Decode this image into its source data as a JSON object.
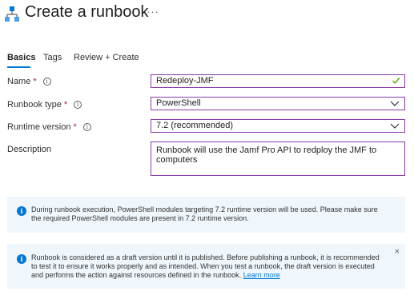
{
  "header": {
    "title": "Create a runbook",
    "more_label": "···"
  },
  "tabs": [
    {
      "label": "Basics",
      "active": true
    },
    {
      "label": "Tags",
      "active": false
    },
    {
      "label": "Review + Create",
      "active": false
    }
  ],
  "form": {
    "name": {
      "label": "Name",
      "required_mark": "*",
      "value": "Redeploy-JMF"
    },
    "runbook_type": {
      "label": "Runbook type",
      "required_mark": "*",
      "value": "PowerShell"
    },
    "runtime_version": {
      "label": "Runtime version",
      "required_mark": "*",
      "value": "7.2 (recommended)"
    },
    "description": {
      "label": "Description",
      "value": "Runbook will use the Jamf Pro API to redploy the JMF to computers"
    }
  },
  "banners": [
    {
      "text": "During runbook execution, PowerShell modules targeting 7.2 runtime version will be used. Please make sure the required PowerShell modules are present in 7.2 runtime version."
    },
    {
      "text": "Runbook is considered as a draft version until it is published. Before publishing a runbook, it is recommended to test it to ensure it works properly and as intended. When you test a runbook, the draft version is executed and performs the action against resources defined in the runbook.",
      "link_label": "Learn more",
      "close_label": "×"
    }
  ],
  "colors": {
    "accent": "#0078d4",
    "field_border": "#8a3aa8",
    "valid_check": "#57a300",
    "banner_bg": "#eff6fc",
    "required": "#a4262c"
  },
  "icons": {
    "logo": "runbook-hierarchy-icon",
    "info": "info-icon",
    "chevron": "chevron-down-icon",
    "check": "check-icon",
    "close": "close-icon"
  }
}
